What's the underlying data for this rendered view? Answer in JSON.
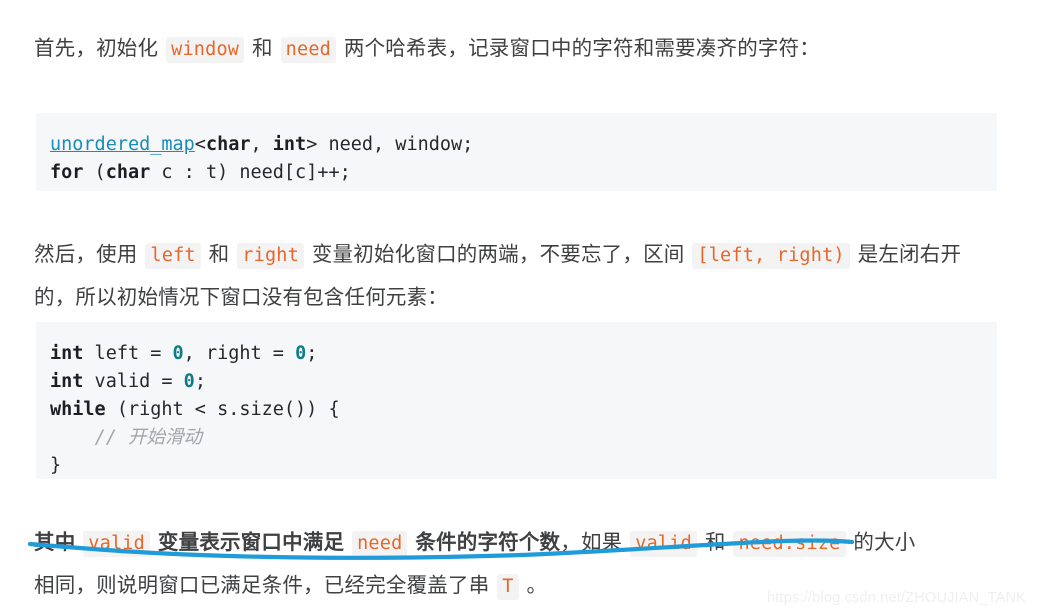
{
  "document": {
    "type": "technical-blog-article",
    "language": "zh-CN",
    "topic": "sliding-window-algorithm"
  },
  "paragraph_1": {
    "segment_1": "首先，初始化 ",
    "code_1": "window",
    "segment_2": " 和 ",
    "code_2": "need",
    "segment_3": " 两个哈希表，记录窗口中的字符和需要凑齐的字符："
  },
  "code_block_1": {
    "language": "cpp",
    "line_1": {
      "type_token": "unordered_map",
      "punct_1": "<",
      "kw_1": "char",
      "punct_2": ", ",
      "kw_2": "int",
      "punct_3": "> need, window;"
    },
    "line_2": {
      "kw_1": "for",
      "punct_1": " (",
      "kw_2": "char",
      "punct_2": " c : t) need[c]++;"
    },
    "plain_text": "unordered_map<char, int> need, window;\nfor (char c : t) need[c]++;"
  },
  "paragraph_2": {
    "segment_1": "然后，使用 ",
    "code_1": "left",
    "segment_2": " 和 ",
    "code_2": "right",
    "segment_3": " 变量初始化窗口的两端，不要忘了，区间 ",
    "code_3": "[left, right)",
    "segment_4": " 是左闭右开的，所以初始情况下窗口没有包含任何元素："
  },
  "code_block_2": {
    "language": "cpp",
    "line_1": {
      "kw_1": "int",
      "p_1": " left = ",
      "num_1": "0",
      "p_2": ", right = ",
      "num_2": "0",
      "p_3": ";"
    },
    "line_2": {
      "kw_1": "int",
      "p_1": " valid = ",
      "num_1": "0",
      "p_2": ";"
    },
    "line_3": {
      "kw_1": "while",
      "p_1": " (right < s.size()) {"
    },
    "line_4": {
      "comment": "// 开始滑动"
    },
    "line_5": {
      "p_1": "}"
    },
    "plain_text": "int left = 0, right = 0;\nint valid = 0;\nwhile (right < s.size()) {\n    // 开始滑动\n}"
  },
  "paragraph_3": {
    "bold_segment_1": "其中 ",
    "bold_code_1": "valid",
    "bold_segment_2": " 变量表示窗口中满足 ",
    "bold_code_2": "need",
    "bold_segment_3": " 条件的字符个数",
    "segment_4": "，如果 ",
    "code_3": "valid",
    "segment_5": " 和 ",
    "code_4": "need.size",
    "segment_6": " 的大小相同，则说明窗口已满足条件，已经完全覆盖了串 ",
    "code_5": "T",
    "segment_7": " 。"
  },
  "annotation": {
    "kind": "hand-drawn-underline-curve",
    "color": "#1e9bd8",
    "stroke_width": 4
  },
  "watermark": {
    "text": "https://blog.csdn.net/ZHOUJIAN_TANK",
    "color": "#efefef"
  },
  "colors": {
    "body_text": "#3f4042",
    "inline_code_text": "#e8662a",
    "inline_code_bg": "#f3f3f3",
    "code_block_bg": "#f6f7f8",
    "code_type": "#1a8cba",
    "code_keyword": "#1c2024",
    "code_number": "#0e7c86",
    "code_comment": "#a3a6a8",
    "annotation_blue": "#1e9bd8"
  }
}
